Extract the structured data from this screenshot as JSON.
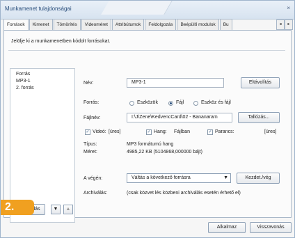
{
  "window": {
    "title": "Munkamenet tulajdonságai",
    "close_label": "×"
  },
  "tabs": [
    {
      "label": "Források"
    },
    {
      "label": "Kimenet"
    },
    {
      "label": "Tömörítés"
    },
    {
      "label": "Videoméret"
    },
    {
      "label": "Attribútumok"
    },
    {
      "label": "Feldolgozás"
    },
    {
      "label": "Beépülő modulok"
    },
    {
      "label": "Bu"
    }
  ],
  "tab_scroll": {
    "left": "◂",
    "right": "▸"
  },
  "instruction": "Jelölje ki a munkamenetben kódolt forrásokat.",
  "list": {
    "items": [
      "Forrás",
      "MP3-1",
      "2. forrás"
    ]
  },
  "form": {
    "name_label": "Név:",
    "name_value": "MP3-1",
    "remove_button": "Eltávolítás",
    "source_label": "Forrás:",
    "radio_devices": "Eszközök",
    "radio_file": "Fájl",
    "radio_device_and_file": "Eszköz és fájl",
    "filename_label": "Fájlnév:",
    "filename_value": "I:\\J\\Zene\\KedvencCard\\02 - Bananaram",
    "browse_button": "Tallózás...",
    "video_label": "Videó:",
    "video_value": "[üres]",
    "audio_label": "Hang:",
    "audio_value": "Fájlban",
    "command_label": "Parancs:",
    "command_value": "[üres]",
    "type_label": "Típus:",
    "type_value": "MP3 formátumú hang",
    "size_label": "Méret:",
    "size_value": "4985,22 KB (5104868,000000 bájt)",
    "end_label": "A végén:",
    "end_select": "Váltás a következő forrásra",
    "start_stop_button": "Kezdet./vég",
    "archive_label": "Archiválás:",
    "archive_value": "(csak közvet lés közbeni archiválás esetén érhető el)"
  },
  "list_controls": {
    "add_button": "Hozzáadás",
    "down_icon": "▼",
    "up_icon": "▲"
  },
  "badge": "2.",
  "footer": {
    "apply_button": "Alkalmaz",
    "cancel_button": "Visszavonás"
  }
}
